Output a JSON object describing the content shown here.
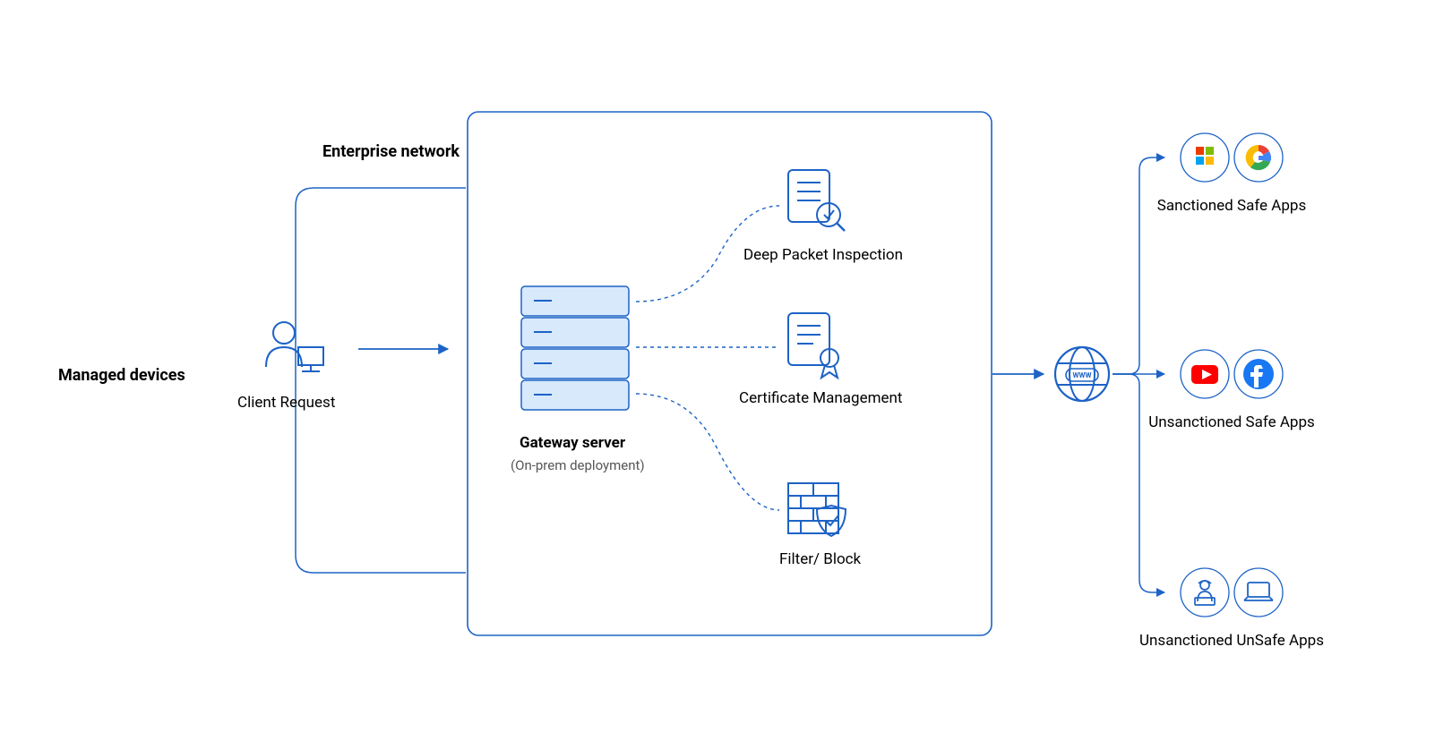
{
  "left": {
    "managed_devices": "Managed devices",
    "client_request": "Client Request"
  },
  "enterprise": {
    "title": "Enterprise network",
    "gateway_title": "Gateway server",
    "gateway_sub": "(On-prem deployment)",
    "dpi": "Deep Packet Inspection",
    "cert": "Certificate Management",
    "filter": "Filter/ Block"
  },
  "apps": {
    "sanctioned_safe": "Sanctioned Safe Apps",
    "unsanctioned_safe": "Unsanctioned Safe Apps",
    "unsanctioned_unsafe": "Unsanctioned UnSafe Apps"
  },
  "icons": {
    "client": "user-workstation-icon",
    "server": "server-icon",
    "dpi": "inspection-icon",
    "cert": "certificate-icon",
    "filter": "firewall-icon",
    "globe": "globe-www-icon",
    "office": "office-icon",
    "google": "google-icon",
    "youtube": "youtube-icon",
    "facebook": "facebook-icon",
    "hacker": "hacker-icon",
    "laptop": "laptop-icon"
  }
}
